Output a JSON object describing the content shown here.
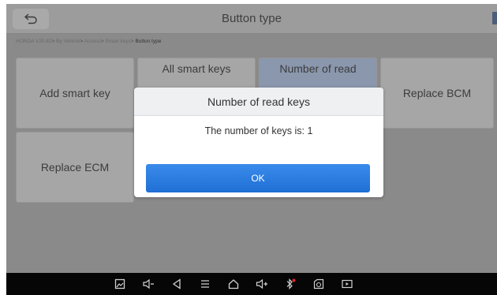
{
  "header": {
    "title": "Button type",
    "back_icon": "back-arrow-icon"
  },
  "breadcrumb": {
    "items": [
      "HONDA V20.82",
      "By Vehicle",
      "Access",
      "Smart keys"
    ],
    "current": "Button type",
    "separator": ">"
  },
  "tiles": [
    {
      "label": "Add smart key",
      "visible_text": "Add smart key"
    },
    {
      "label": "All smart keys",
      "visible_text": "All smart keys"
    },
    {
      "label": "Number of read",
      "visible_text": "Number of read"
    },
    {
      "label": "Replace BCM",
      "visible_text": "Replace BCM"
    },
    {
      "label": "Replace ECM",
      "visible_text": "Replace ECM"
    }
  ],
  "dialog": {
    "title": "Number of read keys",
    "message": "The number of keys is: 1",
    "ok_label": "OK"
  },
  "navbar": {
    "icons": [
      "screenshot-icon",
      "volume-down-icon",
      "back-icon",
      "menu-icon",
      "home-icon",
      "volume-up-icon",
      "bluetooth-icon",
      "vci-icon",
      "screen-record-icon"
    ]
  },
  "colors": {
    "accent": "#2a7be4",
    "dialog_header": "#eef0f2",
    "navbar": "#060606"
  }
}
